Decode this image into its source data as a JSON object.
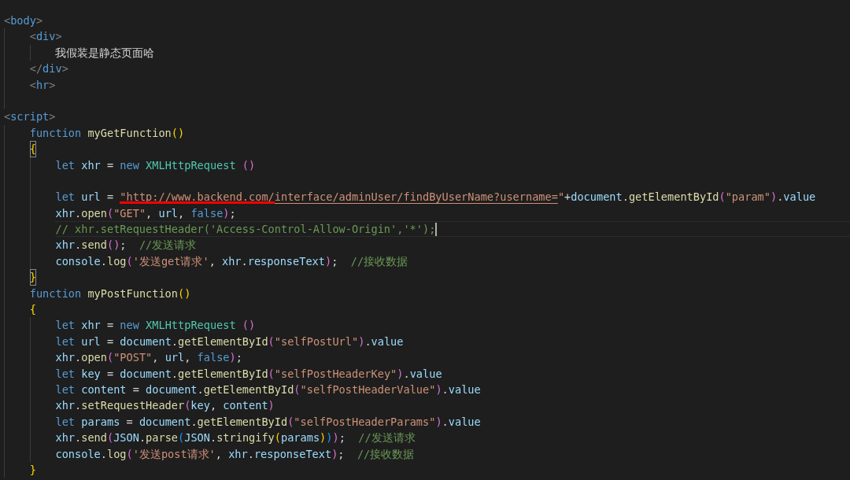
{
  "editor": {
    "lines": [
      {
        "kind": "code",
        "tokens": [
          {
            "kind": "t",
            "text": "<"
          },
          {
            "kind": "tn",
            "text": "body"
          },
          {
            "kind": "t",
            "text": ">"
          }
        ],
        "children": [
          {
            "kind": "code",
            "tokens": [
              {
                "kind": "t",
                "text": "<"
              },
              {
                "kind": "tn",
                "text": "div"
              },
              {
                "kind": "t",
                "text": ">"
              }
            ],
            "children": [
              {
                "kind": "code",
                "tokens": [
                  {
                    "kind": "txt",
                    "text": "我假装是静态页面哈"
                  }
                ]
              }
            ]
          },
          {
            "kind": "code",
            "tokens": [
              {
                "kind": "t",
                "text": "</"
              },
              {
                "kind": "tn",
                "text": "div"
              },
              {
                "kind": "t",
                "text": ">"
              }
            ]
          },
          {
            "kind": "code",
            "tokens": [
              {
                "kind": "t",
                "text": "<"
              },
              {
                "kind": "tn",
                "text": "hr"
              },
              {
                "kind": "t",
                "text": ">"
              }
            ]
          },
          {
            "kind": "blank"
          }
        ]
      },
      {
        "kind": "code",
        "tokens": [
          {
            "kind": "t",
            "text": "<"
          },
          {
            "kind": "tn",
            "text": "script"
          },
          {
            "kind": "t",
            "text": ">"
          }
        ],
        "children": [
          {
            "kind": "code",
            "tokens": [
              {
                "kind": "kw",
                "text": "function "
              },
              {
                "kind": "fn",
                "text": "myGetFunction"
              },
              {
                "kind": "b1",
                "text": "()"
              }
            ]
          },
          {
            "kind": "code",
            "matched": true,
            "tokens": [
              {
                "kind": "b1",
                "text": "{"
              }
            ],
            "children": [
              {
                "kind": "code",
                "tokens": [
                  {
                    "kind": "kw",
                    "text": "let "
                  },
                  {
                    "kind": "v",
                    "text": "xhr"
                  },
                  {
                    "kind": "p",
                    "text": " = "
                  },
                  {
                    "kind": "kw",
                    "text": "new "
                  },
                  {
                    "kind": "cls",
                    "text": "XMLHttpRequest "
                  },
                  {
                    "kind": "b2",
                    "text": "()"
                  }
                ]
              },
              {
                "kind": "blank"
              },
              {
                "kind": "code",
                "annotated": true,
                "tokens": [
                  {
                    "kind": "kw",
                    "text": "let "
                  },
                  {
                    "kind": "v",
                    "text": "url"
                  },
                  {
                    "kind": "p",
                    "text": " = "
                  },
                  {
                    "kind": "sl",
                    "text": "\"http://www.backend.com/"
                  },
                  {
                    "kind": "sl",
                    "text": "interface/adminUser/findByUserName?username="
                  },
                  {
                    "kind": "s",
                    "text": "\""
                  },
                  {
                    "kind": "p",
                    "text": "+"
                  },
                  {
                    "kind": "v",
                    "text": "document"
                  },
                  {
                    "kind": "p",
                    "text": "."
                  },
                  {
                    "kind": "fn",
                    "text": "getElementById"
                  },
                  {
                    "kind": "b2",
                    "text": "("
                  },
                  {
                    "kind": "s",
                    "text": "\"param\""
                  },
                  {
                    "kind": "b2",
                    "text": ")"
                  },
                  {
                    "kind": "p",
                    "text": "."
                  },
                  {
                    "kind": "v",
                    "text": "value"
                  }
                ]
              },
              {
                "kind": "code",
                "tokens": [
                  {
                    "kind": "v",
                    "text": "xhr"
                  },
                  {
                    "kind": "p",
                    "text": "."
                  },
                  {
                    "kind": "fn",
                    "text": "open"
                  },
                  {
                    "kind": "b2",
                    "text": "("
                  },
                  {
                    "kind": "s",
                    "text": "\"GET\""
                  },
                  {
                    "kind": "p",
                    "text": ", "
                  },
                  {
                    "kind": "v",
                    "text": "url"
                  },
                  {
                    "kind": "p",
                    "text": ", "
                  },
                  {
                    "kind": "kw",
                    "text": "false"
                  },
                  {
                    "kind": "b2",
                    "text": ")"
                  },
                  {
                    "kind": "p",
                    "text": ";"
                  }
                ]
              },
              {
                "kind": "code",
                "current": true,
                "tokens": [
                  {
                    "kind": "c",
                    "text": "// xhr.setRequestHeader('Access-Control-Allow-Origin','*');"
                  }
                ]
              },
              {
                "kind": "code",
                "tokens": [
                  {
                    "kind": "v",
                    "text": "xhr"
                  },
                  {
                    "kind": "p",
                    "text": "."
                  },
                  {
                    "kind": "fn",
                    "text": "send"
                  },
                  {
                    "kind": "b2",
                    "text": "()"
                  },
                  {
                    "kind": "p",
                    "text": ";  "
                  },
                  {
                    "kind": "c",
                    "text": "//发送请求"
                  }
                ]
              },
              {
                "kind": "code",
                "tokens": [
                  {
                    "kind": "v",
                    "text": "console"
                  },
                  {
                    "kind": "p",
                    "text": "."
                  },
                  {
                    "kind": "fn",
                    "text": "log"
                  },
                  {
                    "kind": "b2",
                    "text": "("
                  },
                  {
                    "kind": "s",
                    "text": "'发送get请求'"
                  },
                  {
                    "kind": "p",
                    "text": ", "
                  },
                  {
                    "kind": "v",
                    "text": "xhr"
                  },
                  {
                    "kind": "p",
                    "text": "."
                  },
                  {
                    "kind": "v",
                    "text": "responseText"
                  },
                  {
                    "kind": "b2",
                    "text": ")"
                  },
                  {
                    "kind": "p",
                    "text": ";  "
                  },
                  {
                    "kind": "c",
                    "text": "//接收数据"
                  }
                ]
              }
            ]
          },
          {
            "kind": "code",
            "matched": true,
            "tokens": [
              {
                "kind": "b1",
                "text": "}"
              }
            ]
          },
          {
            "kind": "code",
            "tokens": [
              {
                "kind": "kw",
                "text": "function "
              },
              {
                "kind": "fn",
                "text": "myPostFunction"
              },
              {
                "kind": "b1",
                "text": "()"
              }
            ]
          },
          {
            "kind": "code",
            "matched": false,
            "tokens": [
              {
                "kind": "b1",
                "text": "{"
              }
            ],
            "children": [
              {
                "kind": "code",
                "tokens": [
                  {
                    "kind": "kw",
                    "text": "let "
                  },
                  {
                    "kind": "v",
                    "text": "xhr"
                  },
                  {
                    "kind": "p",
                    "text": " = "
                  },
                  {
                    "kind": "kw",
                    "text": "new "
                  },
                  {
                    "kind": "cls",
                    "text": "XMLHttpRequest "
                  },
                  {
                    "kind": "b2",
                    "text": "()"
                  }
                ]
              },
              {
                "kind": "code",
                "tokens": [
                  {
                    "kind": "kw",
                    "text": "let "
                  },
                  {
                    "kind": "v",
                    "text": "url"
                  },
                  {
                    "kind": "p",
                    "text": " = "
                  },
                  {
                    "kind": "v",
                    "text": "document"
                  },
                  {
                    "kind": "p",
                    "text": "."
                  },
                  {
                    "kind": "fn",
                    "text": "getElementById"
                  },
                  {
                    "kind": "b2",
                    "text": "("
                  },
                  {
                    "kind": "s",
                    "text": "\"selfPostUrl\""
                  },
                  {
                    "kind": "b2",
                    "text": ")"
                  },
                  {
                    "kind": "p",
                    "text": "."
                  },
                  {
                    "kind": "v",
                    "text": "value"
                  }
                ]
              },
              {
                "kind": "code",
                "tokens": [
                  {
                    "kind": "v",
                    "text": "xhr"
                  },
                  {
                    "kind": "p",
                    "text": "."
                  },
                  {
                    "kind": "fn",
                    "text": "open"
                  },
                  {
                    "kind": "b2",
                    "text": "("
                  },
                  {
                    "kind": "s",
                    "text": "\"POST\""
                  },
                  {
                    "kind": "p",
                    "text": ", "
                  },
                  {
                    "kind": "v",
                    "text": "url"
                  },
                  {
                    "kind": "p",
                    "text": ", "
                  },
                  {
                    "kind": "kw",
                    "text": "false"
                  },
                  {
                    "kind": "b2",
                    "text": ")"
                  },
                  {
                    "kind": "p",
                    "text": ";"
                  }
                ]
              },
              {
                "kind": "code",
                "tokens": [
                  {
                    "kind": "kw",
                    "text": "let "
                  },
                  {
                    "kind": "v",
                    "text": "key"
                  },
                  {
                    "kind": "p",
                    "text": " = "
                  },
                  {
                    "kind": "v",
                    "text": "document"
                  },
                  {
                    "kind": "p",
                    "text": "."
                  },
                  {
                    "kind": "fn",
                    "text": "getElementById"
                  },
                  {
                    "kind": "b2",
                    "text": "("
                  },
                  {
                    "kind": "s",
                    "text": "\"selfPostHeaderKey\""
                  },
                  {
                    "kind": "b2",
                    "text": ")"
                  },
                  {
                    "kind": "p",
                    "text": "."
                  },
                  {
                    "kind": "v",
                    "text": "value"
                  }
                ]
              },
              {
                "kind": "code",
                "tokens": [
                  {
                    "kind": "kw",
                    "text": "let "
                  },
                  {
                    "kind": "v",
                    "text": "content"
                  },
                  {
                    "kind": "p",
                    "text": " = "
                  },
                  {
                    "kind": "v",
                    "text": "document"
                  },
                  {
                    "kind": "p",
                    "text": "."
                  },
                  {
                    "kind": "fn",
                    "text": "getElementById"
                  },
                  {
                    "kind": "b2",
                    "text": "("
                  },
                  {
                    "kind": "s",
                    "text": "\"selfPostHeaderValue\""
                  },
                  {
                    "kind": "b2",
                    "text": ")"
                  },
                  {
                    "kind": "p",
                    "text": "."
                  },
                  {
                    "kind": "v",
                    "text": "value"
                  }
                ]
              },
              {
                "kind": "code",
                "tokens": [
                  {
                    "kind": "v",
                    "text": "xhr"
                  },
                  {
                    "kind": "p",
                    "text": "."
                  },
                  {
                    "kind": "fn",
                    "text": "setRequestHeader"
                  },
                  {
                    "kind": "b2",
                    "text": "("
                  },
                  {
                    "kind": "v",
                    "text": "key"
                  },
                  {
                    "kind": "p",
                    "text": ", "
                  },
                  {
                    "kind": "v",
                    "text": "content"
                  },
                  {
                    "kind": "b2",
                    "text": ")"
                  }
                ]
              },
              {
                "kind": "code",
                "tokens": [
                  {
                    "kind": "kw",
                    "text": "let "
                  },
                  {
                    "kind": "v",
                    "text": "params"
                  },
                  {
                    "kind": "p",
                    "text": " = "
                  },
                  {
                    "kind": "v",
                    "text": "document"
                  },
                  {
                    "kind": "p",
                    "text": "."
                  },
                  {
                    "kind": "fn",
                    "text": "getElementById"
                  },
                  {
                    "kind": "b2",
                    "text": "("
                  },
                  {
                    "kind": "s",
                    "text": "\"selfPostHeaderParams\""
                  },
                  {
                    "kind": "b2",
                    "text": ")"
                  },
                  {
                    "kind": "p",
                    "text": "."
                  },
                  {
                    "kind": "v",
                    "text": "value"
                  }
                ]
              },
              {
                "kind": "code",
                "tokens": [
                  {
                    "kind": "v",
                    "text": "xhr"
                  },
                  {
                    "kind": "p",
                    "text": "."
                  },
                  {
                    "kind": "fn",
                    "text": "send"
                  },
                  {
                    "kind": "b2",
                    "text": "("
                  },
                  {
                    "kind": "v",
                    "text": "JSON"
                  },
                  {
                    "kind": "p",
                    "text": "."
                  },
                  {
                    "kind": "fn",
                    "text": "parse"
                  },
                  {
                    "kind": "b3",
                    "text": "("
                  },
                  {
                    "kind": "v",
                    "text": "JSON"
                  },
                  {
                    "kind": "p",
                    "text": "."
                  },
                  {
                    "kind": "fn",
                    "text": "stringify"
                  },
                  {
                    "kind": "b1",
                    "text": "("
                  },
                  {
                    "kind": "v",
                    "text": "params"
                  },
                  {
                    "kind": "b1",
                    "text": ")"
                  },
                  {
                    "kind": "b3",
                    "text": ")"
                  },
                  {
                    "kind": "b2",
                    "text": ")"
                  },
                  {
                    "kind": "p",
                    "text": ";  "
                  },
                  {
                    "kind": "c",
                    "text": "//发送请求"
                  }
                ]
              },
              {
                "kind": "code",
                "tokens": [
                  {
                    "kind": "v",
                    "text": "console"
                  },
                  {
                    "kind": "p",
                    "text": "."
                  },
                  {
                    "kind": "fn",
                    "text": "log"
                  },
                  {
                    "kind": "b2",
                    "text": "("
                  },
                  {
                    "kind": "s",
                    "text": "'发送post请求'"
                  },
                  {
                    "kind": "p",
                    "text": ", "
                  },
                  {
                    "kind": "v",
                    "text": "xhr"
                  },
                  {
                    "kind": "p",
                    "text": "."
                  },
                  {
                    "kind": "v",
                    "text": "responseText"
                  },
                  {
                    "kind": "b2",
                    "text": ")"
                  },
                  {
                    "kind": "p",
                    "text": ";  "
                  },
                  {
                    "kind": "c",
                    "text": "//接收数据"
                  }
                ]
              }
            ]
          },
          {
            "kind": "code",
            "matched": false,
            "tokens": [
              {
                "kind": "b1",
                "text": "}"
              }
            ]
          }
        ]
      }
    ]
  }
}
